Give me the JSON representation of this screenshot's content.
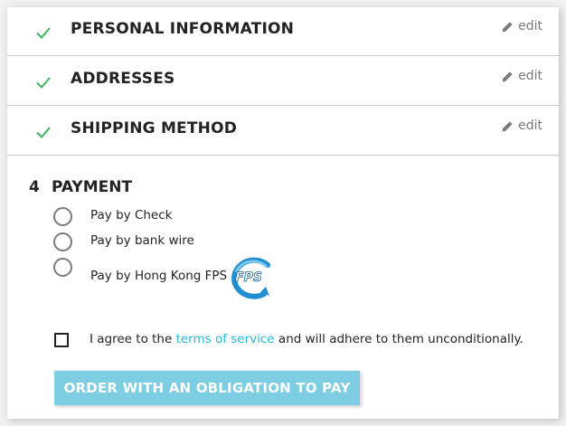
{
  "steps": [
    {
      "title": "PERSONAL INFORMATION",
      "edit": "edit"
    },
    {
      "title": "ADDRESSES",
      "edit": "edit"
    },
    {
      "title": "SHIPPING METHOD",
      "edit": "edit"
    }
  ],
  "payment": {
    "number": "4",
    "title": "PAYMENT",
    "options": [
      {
        "label": "Pay by Check"
      },
      {
        "label": "Pay by bank wire"
      },
      {
        "label": "Pay by Hong Kong FPS"
      }
    ],
    "fps_logo_text": "FPS",
    "agree_prefix": "I agree to the ",
    "agree_link": "terms of service",
    "agree_suffix": " and will adhere to them unconditionally.",
    "order_button": "ORDER WITH AN OBLIGATION TO PAY"
  },
  "colors": {
    "check": "#3fb55d",
    "link": "#24b9d7",
    "button": "#7dcde3"
  },
  "icons": {
    "step_done": "checkmark-icon",
    "edit": "pencil-icon"
  }
}
